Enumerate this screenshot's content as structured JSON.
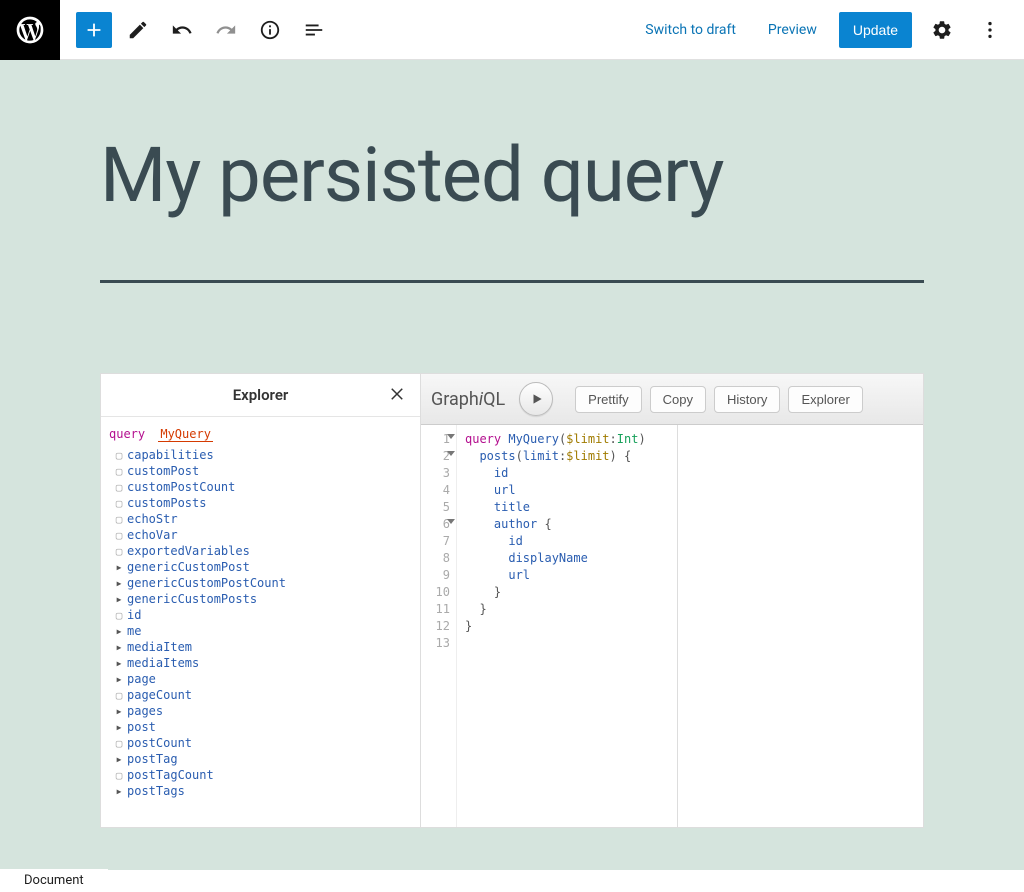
{
  "toolbar": {
    "switch_draft": "Switch to draft",
    "preview": "Preview",
    "update": "Update"
  },
  "page": {
    "title": "My persisted query"
  },
  "explorer": {
    "title": "Explorer",
    "query_keyword": "query",
    "query_name": "MyQuery",
    "fields": [
      {
        "name": "capabilities",
        "type": "box"
      },
      {
        "name": "customPost",
        "type": "box"
      },
      {
        "name": "customPostCount",
        "type": "box"
      },
      {
        "name": "customPosts",
        "type": "box"
      },
      {
        "name": "echoStr",
        "type": "box"
      },
      {
        "name": "echoVar",
        "type": "box"
      },
      {
        "name": "exportedVariables",
        "type": "box"
      },
      {
        "name": "genericCustomPost",
        "type": "arrow"
      },
      {
        "name": "genericCustomPostCount",
        "type": "arrow"
      },
      {
        "name": "genericCustomPosts",
        "type": "arrow"
      },
      {
        "name": "id",
        "type": "box"
      },
      {
        "name": "me",
        "type": "arrow"
      },
      {
        "name": "mediaItem",
        "type": "arrow"
      },
      {
        "name": "mediaItems",
        "type": "arrow"
      },
      {
        "name": "page",
        "type": "arrow"
      },
      {
        "name": "pageCount",
        "type": "box"
      },
      {
        "name": "pages",
        "type": "arrow"
      },
      {
        "name": "post",
        "type": "arrow"
      },
      {
        "name": "postCount",
        "type": "box"
      },
      {
        "name": "postTag",
        "type": "arrow"
      },
      {
        "name": "postTagCount",
        "type": "box"
      },
      {
        "name": "postTags",
        "type": "arrow"
      }
    ]
  },
  "graphiql": {
    "logo": "GraphiQL",
    "prettify": "Prettify",
    "copy": "Copy",
    "history": "History",
    "explorer": "Explorer",
    "lines": [
      1,
      2,
      3,
      4,
      5,
      6,
      7,
      8,
      9,
      10,
      11,
      12,
      13
    ],
    "fold_lines": [
      1,
      2,
      6
    ],
    "code": {
      "l1_kw": "query",
      "l1_name": "MyQuery",
      "l1_var": "$limit",
      "l1_type": "Int",
      "l2_field": "posts",
      "l2_arg": "limit",
      "l2_var": "$limit",
      "l3": "id",
      "l4": "url",
      "l5": "title",
      "l6": "author",
      "l7": "id",
      "l8": "displayName",
      "l9": "url"
    }
  },
  "footer": {
    "document": "Document"
  }
}
